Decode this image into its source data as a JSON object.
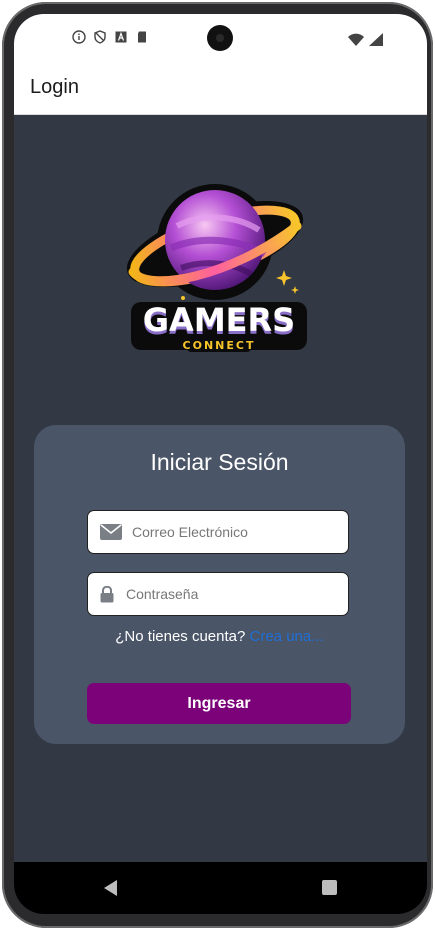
{
  "app_bar": {
    "title": "Login"
  },
  "status_bar": {
    "left_icons": [
      "info-icon",
      "shield-icon",
      "a-icon",
      "sd-card-icon"
    ],
    "right_icons": [
      "wifi-icon",
      "signal-icon"
    ]
  },
  "logo": {
    "title": "GAMERS",
    "subtitle": "CONNECT"
  },
  "login_card": {
    "title": "Iniciar Sesión",
    "email": {
      "value": "",
      "placeholder": "Correo Electrónico",
      "icon": "envelope-icon"
    },
    "password": {
      "value": "",
      "placeholder": "Contraseña",
      "icon": "lock-icon"
    },
    "signup_prompt": "¿No tienes cuenta?",
    "signup_link": "Crea una...",
    "submit_label": "Ingresar"
  },
  "nav_bar": {
    "icons": [
      "back-icon",
      "recents-icon"
    ]
  },
  "colors": {
    "background": "#323844",
    "card": "#4a5567",
    "button": "#7b0279",
    "link": "#1f6fd6"
  }
}
